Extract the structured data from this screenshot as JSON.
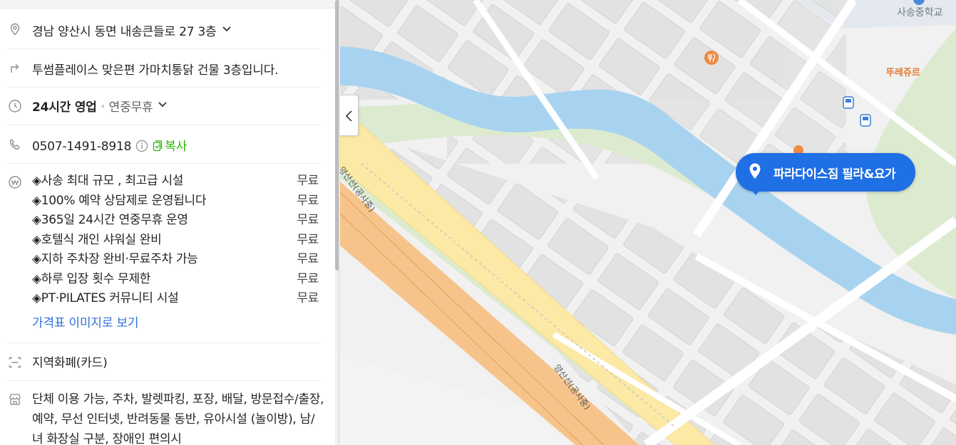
{
  "place": {
    "address": "경남 양산시 동면 내송큰들로 27 3층",
    "directions": "투썸플레이스 맞은편 가마치통닭 건물 3층입니다.",
    "hours": {
      "status": "24시간 영업",
      "note": "연중무휴"
    },
    "phone": "0507-1491-8918",
    "copy_label": "복사",
    "prices": [
      {
        "name": "◈사송 최대 규모 , 최고급 시설",
        "price": "무료"
      },
      {
        "name": "◈100% 예약 상담제로 운영됩니다",
        "price": "무료"
      },
      {
        "name": "◈365일 24시간 연중무휴 운영",
        "price": "무료"
      },
      {
        "name": "◈호텔식 개인 샤워실 완비",
        "price": "무료"
      },
      {
        "name": "◈지하 주차장 완비·무료주차 가능",
        "price": "무료"
      },
      {
        "name": "◈하루 입장 횟수 무제한",
        "price": "무료"
      },
      {
        "name": "◈PT·PILATES 커뮤니티 시설",
        "price": "무료"
      }
    ],
    "price_image_link": "가격표 이미지로 보기",
    "currency": "지역화폐(카드)",
    "facilities": "단체 이용 가능, 주차, 발렛파킹, 포장, 배달, 방문접수/출장, 예약, 무선 인터넷, 반려동물 동반, 유아시설 (놀이방), 남/녀 화장실 구분, 장애인 편의시"
  },
  "map": {
    "marker_label": "파라다이스짐 필라&요가",
    "labels": {
      "school": "사송중학교",
      "restaurant": "뚜레쥬르",
      "road_1": "양산선(공사중)",
      "road_2": "양산선(공사중)"
    },
    "colors": {
      "accent": "#1f6fe5",
      "river": "#a8d3f0",
      "road_yellow": "#fbe9a5",
      "road_orange": "#f6c48b",
      "green": "#dcebd0"
    }
  },
  "icons": {
    "address": "location-pin-icon",
    "directions": "turn-arrow-icon",
    "hours": "clock-icon",
    "phone": "phone-icon",
    "prices": "won-icon",
    "currency": "card-scan-icon",
    "facilities": "store-icon"
  }
}
